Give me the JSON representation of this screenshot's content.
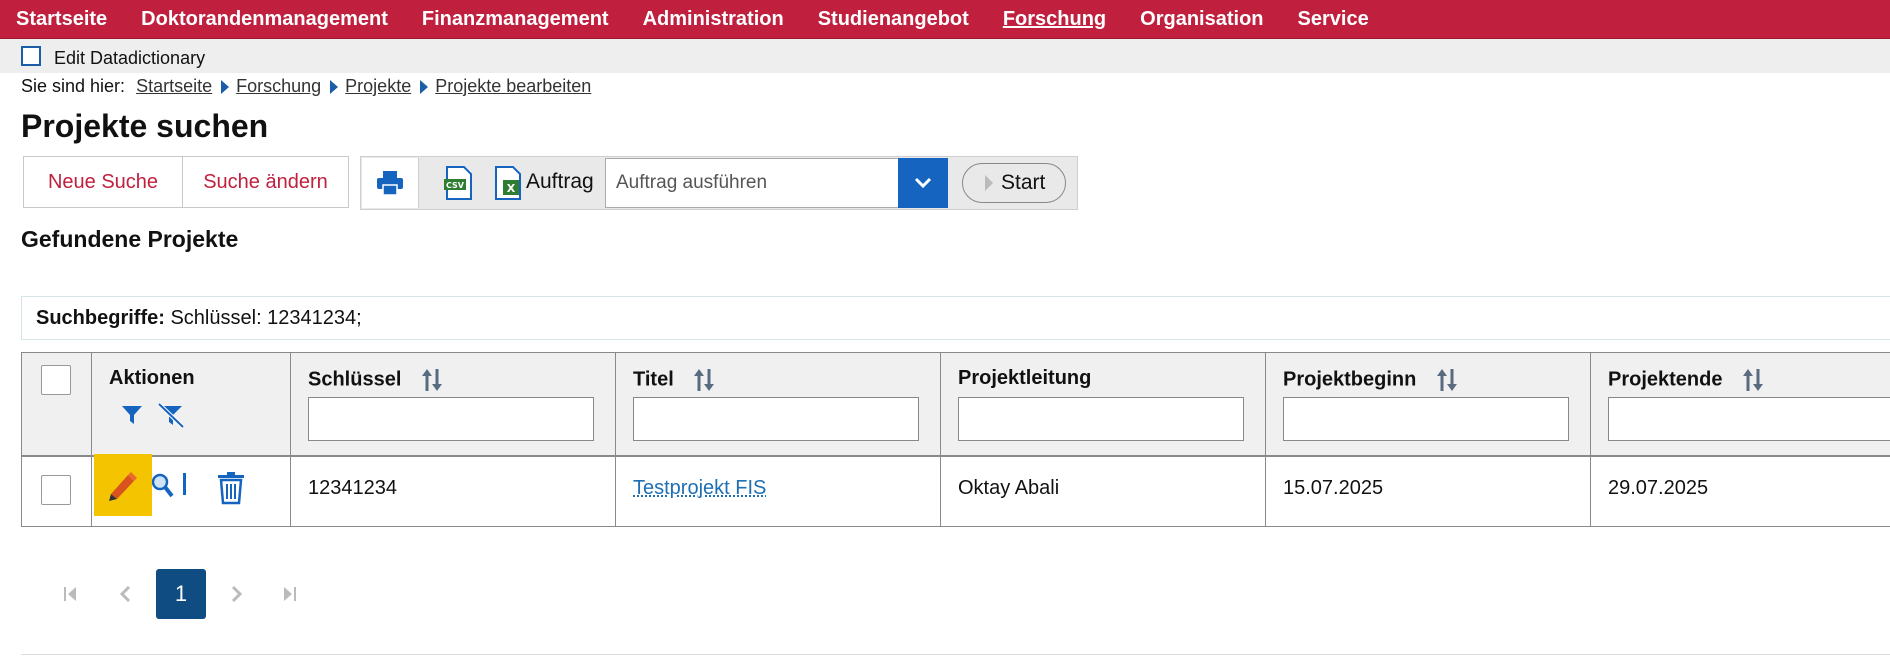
{
  "nav": {
    "items": [
      "Startseite",
      "Doktorandenmanagement",
      "Finanzmanagement",
      "Administration",
      "Studienangebot",
      "Forschung",
      "Organisation",
      "Service"
    ],
    "active": "Forschung"
  },
  "datadictionary": {
    "label": "Edit Datadictionary"
  },
  "breadcrumb": {
    "prefix": "Sie sind hier:",
    "items": [
      "Startseite",
      "Forschung",
      "Projekte",
      "Projekte bearbeiten"
    ]
  },
  "page": {
    "title": "Projekte suchen",
    "section_title": "Gefundene Projekte"
  },
  "toolbar": {
    "new_search": "Neue Suche",
    "change_search": "Suche ändern",
    "print_icon": "printer-icon",
    "csv_icon": "csv-export-icon",
    "excel_icon": "excel-export-icon",
    "auftrag_label": "Auftrag",
    "auftrag_placeholder": "Auftrag ausführen",
    "start_label": "Start"
  },
  "search_terms": {
    "label": "Suchbegriffe:",
    "value": "Schlüssel: 12341234;"
  },
  "table": {
    "headers": {
      "actions": "Aktionen",
      "key": "Schlüssel",
      "title": "Titel",
      "lead": "Projektleitung",
      "start": "Projektbeginn",
      "end": "Projektende"
    },
    "rows": [
      {
        "key": "12341234",
        "title": "Testprojekt FIS",
        "lead": "Oktay Abali",
        "start": "15.07.2025",
        "end": "29.07.2025"
      }
    ]
  },
  "pagination": {
    "current": "1"
  },
  "colors": {
    "brand": "#c0203e",
    "accent": "#1565c0",
    "highlight": "#f5c400"
  }
}
